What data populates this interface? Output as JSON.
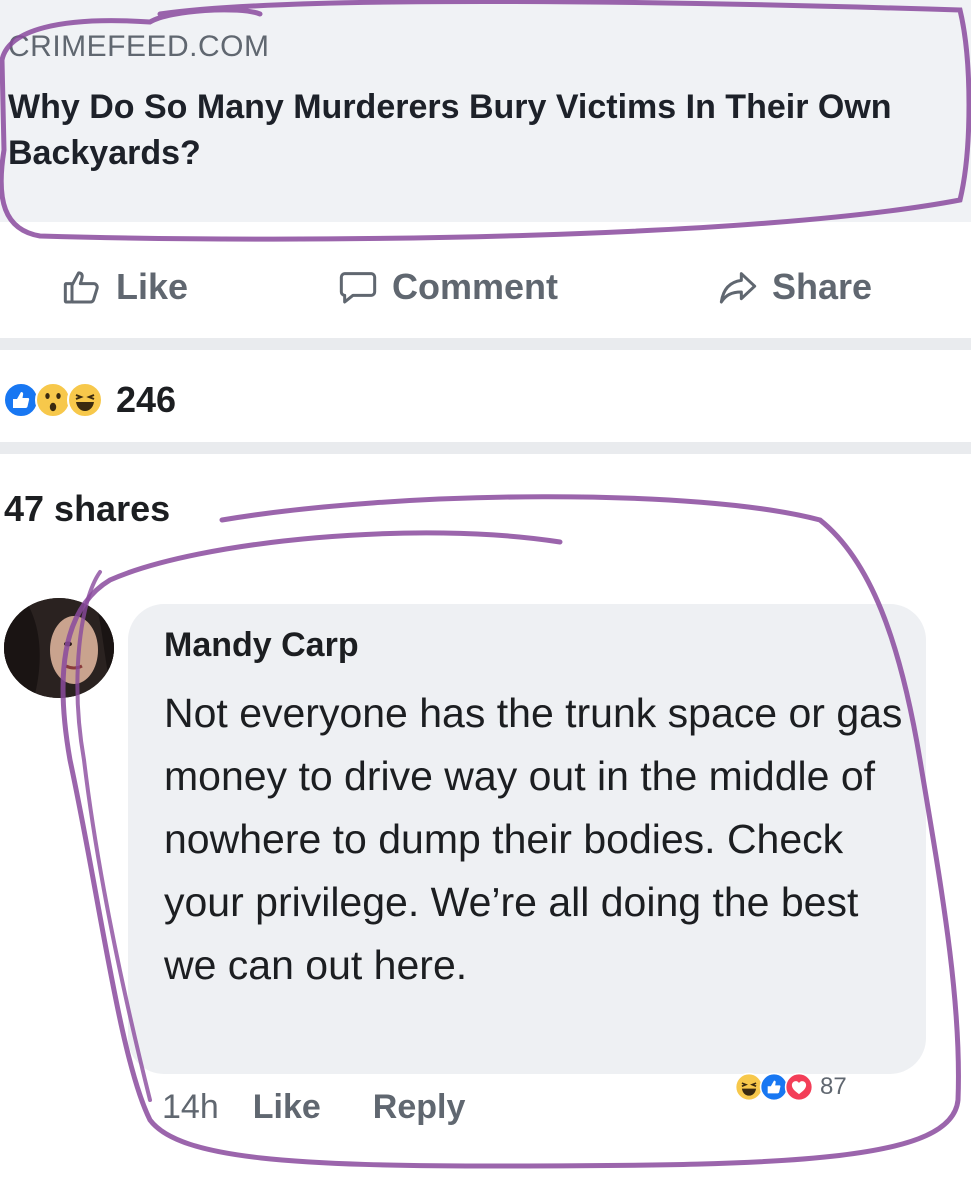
{
  "link_preview": {
    "source": "CRIMEFEED.COM",
    "title": "Why Do So Many Murderers Bury Victims In Their Own Backyards?"
  },
  "actions": {
    "like": "Like",
    "comment": "Comment",
    "share": "Share",
    "like_icon": "thumbs-up-icon",
    "comment_icon": "comment-bubble-icon",
    "share_icon": "share-arrow-icon"
  },
  "reactions": {
    "icons": [
      "like-reaction-icon",
      "wow-reaction-icon",
      "haha-reaction-icon"
    ],
    "count": "246"
  },
  "shares": "47 shares",
  "comment": {
    "author": "Mandy Carp",
    "text": "Not everyone has the trunk space or gas money to drive way out in the middle of nowhere to dump their bodies. Check your privilege. We’re all doing the best we can out here.",
    "time": "14h",
    "like": "Like",
    "reply": "Reply",
    "reaction_icons": [
      "haha-reaction-icon",
      "like-reaction-icon",
      "love-reaction-icon"
    ],
    "reaction_count": "87"
  },
  "colors": {
    "card_background": "#f0f2f5",
    "secondary_text": "#606770",
    "like_blue": "#1877f2",
    "love_red": "#f33e58",
    "haha_yellow": "#f7c84b",
    "annotation_purple": "#8a4a9e"
  }
}
